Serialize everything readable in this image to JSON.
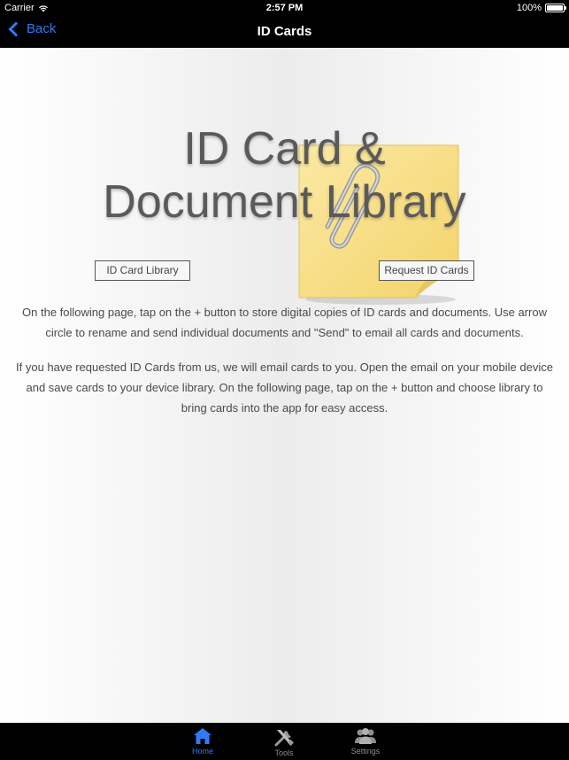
{
  "status_bar": {
    "carrier": "Carrier",
    "time": "2:57 PM",
    "battery": "100%"
  },
  "nav": {
    "back_label": "Back",
    "title": "ID Cards"
  },
  "hero": {
    "title_line1": "ID Card &",
    "title_line2": "Document Library"
  },
  "buttons": {
    "library": "ID Card Library",
    "request": "Request ID Cards"
  },
  "paragraphs": {
    "p1_line1": "On the following page, tap on the + button to store digital copies of ID cards and documents.  Use arrow",
    "p1_line2": "circle to rename and send individual documents and \"Send\" to email all cards and documents.",
    "p2_line1": "If you have requested ID Cards from us, we will email cards to you.  Open the email on your mobile device",
    "p2_line2": "and save cards to your device library.  On the following page, tap on the + button and choose library to",
    "p2_line3": "bring cards into the app for easy access."
  },
  "tabs": [
    {
      "label": "Home",
      "icon": "home-icon",
      "active": true
    },
    {
      "label": "Tools",
      "icon": "tools-icon",
      "active": false
    },
    {
      "label": "Settings",
      "icon": "settings-icon",
      "active": false
    }
  ],
  "colors": {
    "accent": "#2f7cf6",
    "tab_inactive": "#8e8e8e",
    "bar_bg": "#000000",
    "note_yellow": "#f7e08a"
  }
}
